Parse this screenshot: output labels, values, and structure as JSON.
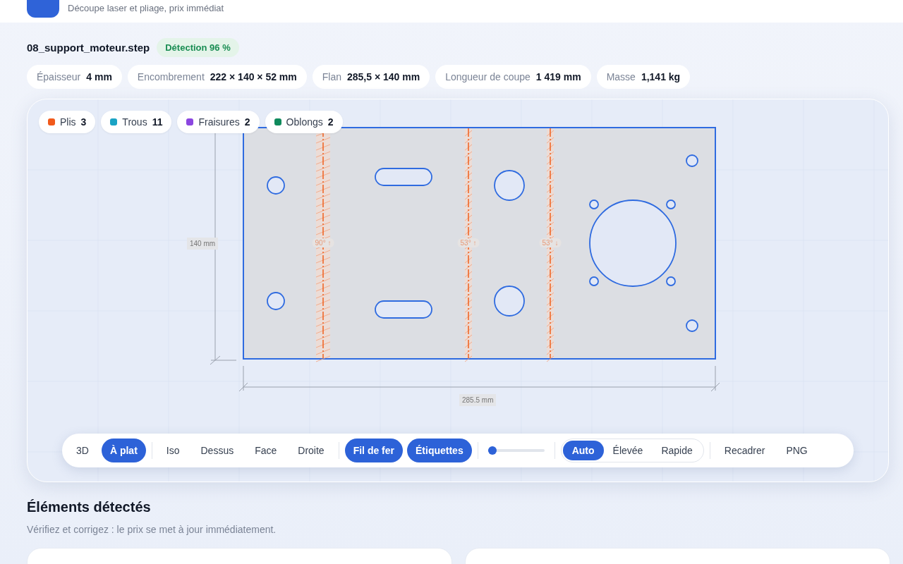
{
  "header": {
    "subtitle": "Découpe laser et pliage, prix immédiat"
  },
  "file": {
    "name": "08_support_moteur.step",
    "detection": "Détection 96 %"
  },
  "specs": [
    {
      "label": "Épaisseur",
      "value": "4 mm"
    },
    {
      "label": "Encombrement",
      "value": "222 × 140 × 52 mm"
    },
    {
      "label": "Flan",
      "value": "285,5 × 140 mm"
    },
    {
      "label": "Longueur de coupe",
      "value": "1 419 mm"
    },
    {
      "label": "Masse",
      "value": "1,141 kg"
    }
  ],
  "features": [
    {
      "label": "Plis",
      "count": "3",
      "color": "#f15a1b"
    },
    {
      "label": "Trous",
      "count": "11",
      "color": "#1aa3c4"
    },
    {
      "label": "Fraisures",
      "count": "2",
      "color": "#8b46e0"
    },
    {
      "label": "Oblongs",
      "count": "2",
      "color": "#108a5c"
    }
  ],
  "drawing": {
    "bends": [
      {
        "label": "90° ↑"
      },
      {
        "label": "53° ↑"
      },
      {
        "label": "53° ↓"
      }
    ],
    "height_label": "140 mm",
    "width_label": "285.5 mm"
  },
  "toolbar": [
    {
      "kind": "buttons",
      "items": [
        {
          "label": "3D",
          "selected": false
        },
        {
          "label": "À plat",
          "selected": true
        }
      ]
    },
    {
      "kind": "buttons",
      "items": [
        {
          "label": "Iso",
          "selected": false
        },
        {
          "label": "Dessus",
          "selected": false
        },
        {
          "label": "Face",
          "selected": false
        },
        {
          "label": "Droite",
          "selected": false
        }
      ]
    },
    {
      "kind": "buttons",
      "items": [
        {
          "label": "Fil de fer",
          "selected": true
        },
        {
          "label": "Étiquettes",
          "selected": true
        }
      ]
    },
    {
      "kind": "slider",
      "level": 0.08
    },
    {
      "kind": "segment",
      "items": [
        {
          "label": "Auto",
          "selected": true
        },
        {
          "label": "Élevée",
          "selected": false
        },
        {
          "label": "Rapide",
          "selected": false
        }
      ]
    },
    {
      "kind": "buttons",
      "items": [
        {
          "label": "Recadrer",
          "selected": false
        },
        {
          "label": "PNG",
          "selected": false
        }
      ]
    }
  ],
  "section": {
    "title": "Éléments détectés",
    "subtitle": "Vérifiez et corrigez : le prix se met à jour immédiatement."
  }
}
